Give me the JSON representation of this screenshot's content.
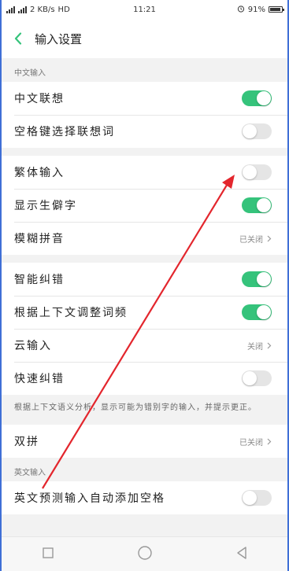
{
  "status_bar": {
    "network_speed": "2 KB/s",
    "network_tag": "HD",
    "time": "11:21",
    "battery": "91%",
    "battery_level": 0.91
  },
  "header": {
    "title": "输入设置"
  },
  "sections": {
    "chinese_label": "中文输入",
    "english_label": "英文输入"
  },
  "rows": {
    "lianxiang": {
      "label": "中文联想",
      "on": true
    },
    "kongge": {
      "label": "空格键选择联想词",
      "on": false
    },
    "fanti": {
      "label": "繁体输入",
      "on": false
    },
    "shengpizi": {
      "label": "显示生僻字",
      "on": true
    },
    "mohu": {
      "label": "模糊拼音",
      "value": "已关闭"
    },
    "jiucuo": {
      "label": "智能纠错",
      "on": true
    },
    "tiaozheng": {
      "label": "根据上下文调整词频",
      "on": true
    },
    "yunshuru": {
      "label": "云输入",
      "value": "关闭"
    },
    "kuaisu": {
      "label": "快速纠错",
      "on": false
    },
    "shuangpin": {
      "label": "双拼",
      "value": "已关闭"
    },
    "yingwen": {
      "label": "英文预测输入自动添加空格",
      "on": false
    }
  },
  "hint_text": "根据上下文语义分析，显示可能为错别字的输入，并提示更正。",
  "colors": {
    "toggle_on": "#35c37b",
    "toggle_off": "#e5e5e5",
    "back_arrow": "#35c37b",
    "annotation_arrow": "#e3262d"
  }
}
